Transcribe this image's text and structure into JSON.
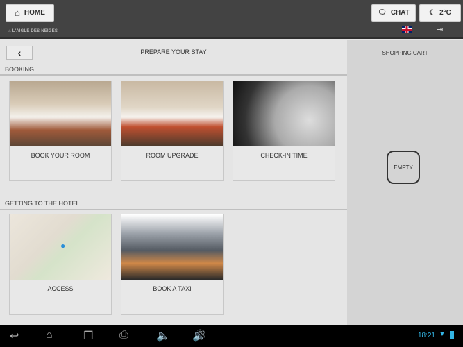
{
  "header": {
    "home_label": "HOME",
    "chat_label": "CHAT",
    "weather_label": "2°C",
    "breadcrumb": "L'AIGLE DES NEIGES",
    "language": "uk-flag-icon"
  },
  "page": {
    "title": "PREPARE YOUR STAY"
  },
  "sections": [
    {
      "title": "BOOKING",
      "items": [
        {
          "label": "BOOK YOUR ROOM"
        },
        {
          "label": "ROOM UPGRADE"
        },
        {
          "label": "CHECK-IN TIME"
        }
      ]
    },
    {
      "title": "GETTING TO THE HOTEL",
      "items": [
        {
          "label": "ACCESS"
        },
        {
          "label": "BOOK A TAXI"
        }
      ]
    }
  ],
  "cart": {
    "title": "SHOPPING CART",
    "empty_label": "EMPTY"
  },
  "status": {
    "time": "18:21"
  },
  "colors": {
    "topbar": "#434343",
    "accent": "#33b5e5"
  }
}
